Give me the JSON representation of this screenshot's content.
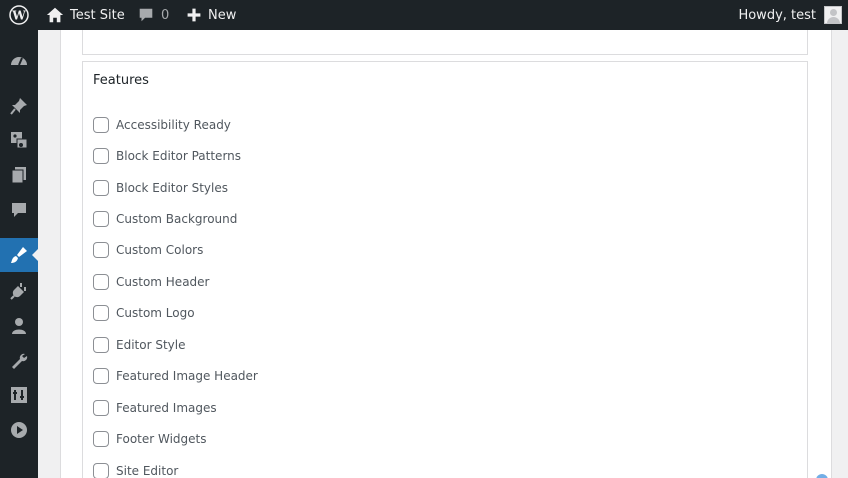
{
  "admin_bar": {
    "site_name": "Test Site",
    "comment_count": "0",
    "new_label": "New",
    "greeting": "Howdy, test"
  },
  "sidebar": {
    "items": [
      {
        "icon": "dashboard-icon",
        "active": false
      },
      {
        "icon": "posts-pin-icon",
        "active": false
      },
      {
        "icon": "media-icon",
        "active": false
      },
      {
        "icon": "pages-icon",
        "active": false
      },
      {
        "icon": "comments-icon",
        "active": false
      },
      {
        "icon": "appearance-brush-icon",
        "active": true
      },
      {
        "icon": "plugins-icon",
        "active": false
      },
      {
        "icon": "users-icon",
        "active": false
      },
      {
        "icon": "tools-wrench-icon",
        "active": false
      },
      {
        "icon": "settings-icon",
        "active": false
      },
      {
        "icon": "media-play-icon",
        "active": false
      }
    ]
  },
  "features": {
    "title": "Features",
    "items": [
      {
        "label": "Accessibility Ready",
        "checked": false
      },
      {
        "label": "Block Editor Patterns",
        "checked": false
      },
      {
        "label": "Block Editor Styles",
        "checked": false
      },
      {
        "label": "Custom Background",
        "checked": false
      },
      {
        "label": "Custom Colors",
        "checked": false
      },
      {
        "label": "Custom Header",
        "checked": false
      },
      {
        "label": "Custom Logo",
        "checked": false
      },
      {
        "label": "Editor Style",
        "checked": false
      },
      {
        "label": "Featured Image Header",
        "checked": false
      },
      {
        "label": "Featured Images",
        "checked": false
      },
      {
        "label": "Footer Widgets",
        "checked": false
      },
      {
        "label": "Site Editor",
        "checked": false
      }
    ]
  },
  "colors": {
    "admin_bar_bg": "#1d2327",
    "accent": "#2271b1",
    "page_bg": "#f0f0f1"
  }
}
